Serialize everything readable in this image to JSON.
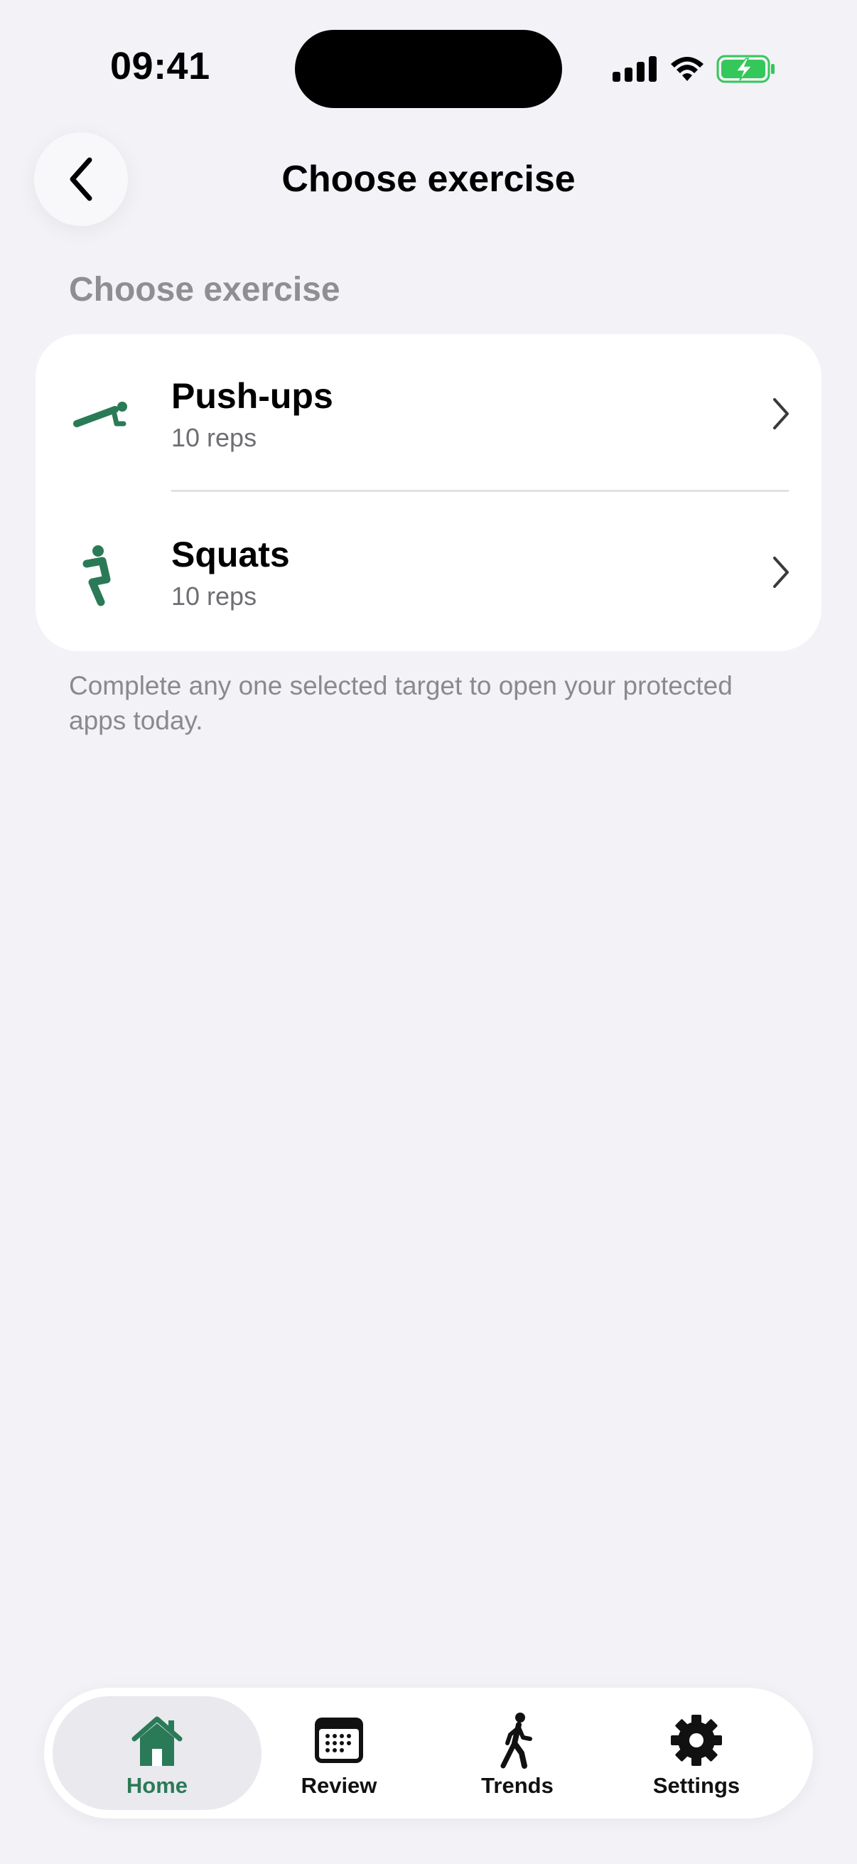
{
  "status_bar": {
    "time": "09:41"
  },
  "nav": {
    "title": "Choose exercise",
    "back_icon": "chevron-left-icon"
  },
  "section_header": "Choose exercise",
  "exercises": [
    {
      "name": "Push-ups",
      "target": "10 reps",
      "icon": "pushup-icon"
    },
    {
      "name": "Squats",
      "target": "10 reps",
      "icon": "squat-icon"
    }
  ],
  "footnote": "Complete any one selected target to open your protected apps today.",
  "tabs": [
    {
      "label": "Home",
      "icon": "house-icon",
      "active": true
    },
    {
      "label": "Review",
      "icon": "calendar-icon",
      "active": false
    },
    {
      "label": "Trends",
      "icon": "walking-figure-icon",
      "active": false
    },
    {
      "label": "Settings",
      "icon": "gear-icon",
      "active": false
    }
  ],
  "colors": {
    "accent": "#2b7a57",
    "background": "#f2f2f7",
    "battery": "#34c759"
  }
}
